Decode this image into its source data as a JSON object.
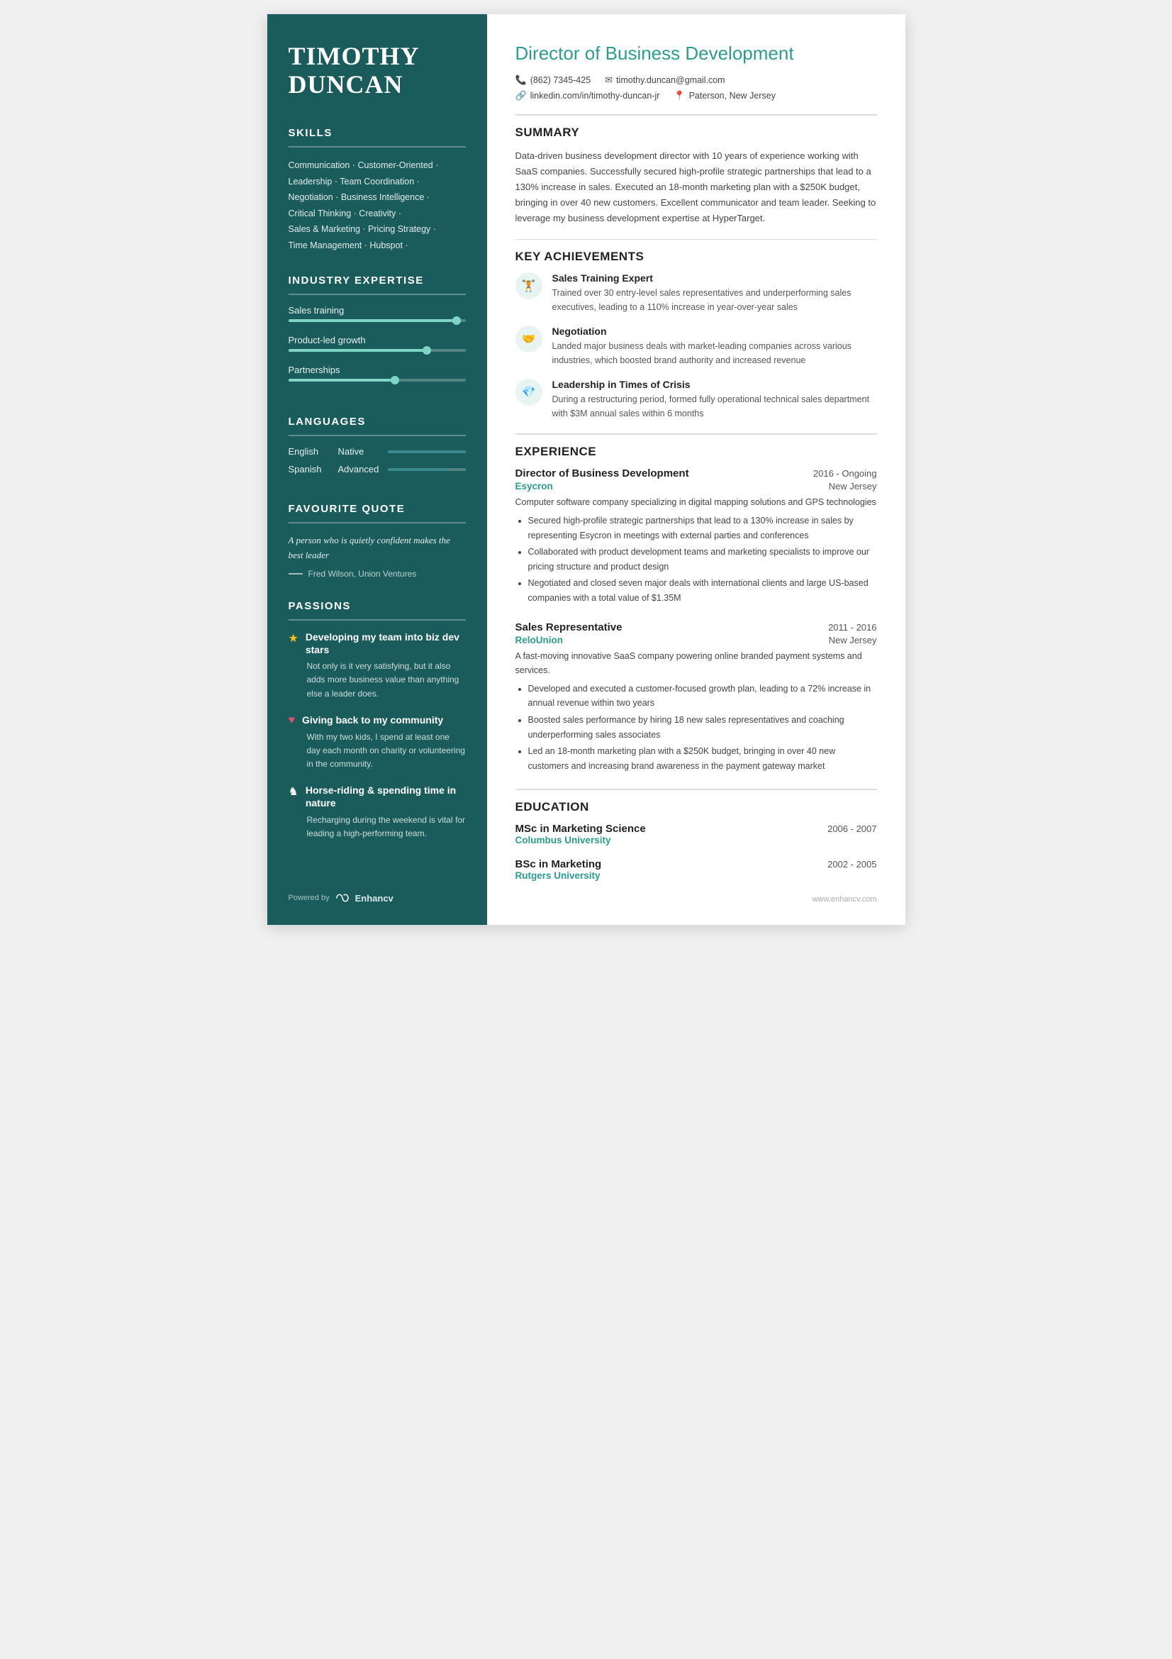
{
  "sidebar": {
    "name_line1": "TIMOTHY",
    "name_line2": "DUNCAN",
    "sections": {
      "skills": {
        "title": "SKILLS",
        "text_lines": [
          "Communication · Customer-Oriented ·",
          "Leadership · Team Coordination ·",
          "Negotiation · Business Intelligence ·",
          "Critical Thinking · Creativity ·",
          "Sales & Marketing · Pricing Strategy ·",
          "Time Management · Hubspot ·"
        ]
      },
      "expertise": {
        "title": "INDUSTRY EXPERTISE",
        "items": [
          {
            "label": "Sales training",
            "percent": 95
          },
          {
            "label": "Product-led growth",
            "percent": 78
          },
          {
            "label": "Partnerships",
            "percent": 60
          }
        ]
      },
      "languages": {
        "title": "LANGUAGES",
        "items": [
          {
            "name": "English",
            "level": "Native",
            "percent": 100
          },
          {
            "name": "Spanish",
            "level": "Advanced",
            "percent": 75
          }
        ]
      },
      "quote": {
        "title": "FAVOURITE QUOTE",
        "text": "A person who is quietly confident makes the best leader",
        "author": "Fred Wilson, Union Ventures"
      },
      "passions": {
        "title": "PASSIONS",
        "items": [
          {
            "icon": "★",
            "title": "Developing my team into biz dev stars",
            "desc": "Not only is it very satisfying, but it also adds more business value than anything else a leader does."
          },
          {
            "icon": "♥",
            "title": "Giving back to my community",
            "desc": "With my two kids, I spend at least one day each month on charity or volunteering in the community."
          },
          {
            "icon": "♞",
            "title": "Horse-riding & spending time in nature",
            "desc": "Recharging during the weekend is vital for leading a high-performing team."
          }
        ]
      }
    },
    "footer": {
      "powered_by": "Powered by",
      "logo_symbol": "∞",
      "logo_name": "Enhancv"
    }
  },
  "main": {
    "title": "Director of Business Development",
    "contact": {
      "phone_icon": "📞",
      "phone": "(862) 7345-425",
      "email_icon": "✉",
      "email": "timothy.duncan@gmail.com",
      "linkedin_icon": "🔗",
      "linkedin": "linkedin.com/in/timothy-duncan-jr",
      "location_icon": "📍",
      "location": "Paterson, New Jersey"
    },
    "summary": {
      "title": "SUMMARY",
      "text": "Data-driven business development director with 10 years of experience working with SaaS companies. Successfully secured high-profile strategic partnerships that lead to a 130% increase in sales. Executed an 18-month marketing plan with a $250K budget, bringing in over 40 new customers. Excellent communicator and team leader. Seeking to leverage my business development expertise at HyperTarget."
    },
    "achievements": {
      "title": "KEY ACHIEVEMENTS",
      "items": [
        {
          "icon": "🏋",
          "title": "Sales Training Expert",
          "desc": "Trained over 30 entry-level sales representatives and underperforming sales executives, leading to a 110% increase in year-over-year sales"
        },
        {
          "icon": "🤝",
          "title": "Negotiation",
          "desc": "Landed major business deals with market-leading companies across various industries, which boosted brand authority and increased revenue"
        },
        {
          "icon": "💎",
          "title": "Leadership in Times of Crisis",
          "desc": "During a restructuring period, formed fully operational technical sales department with $3M annual sales within 6 months"
        }
      ]
    },
    "experience": {
      "title": "EXPERIENCE",
      "items": [
        {
          "title": "Director of Business Development",
          "dates": "2016 - Ongoing",
          "company": "Esycron",
          "location": "New Jersey",
          "desc": "Computer software company specializing in digital mapping solutions and GPS technologies",
          "bullets": [
            "Secured high-profile strategic partnerships that lead to a 130% increase in sales by representing Esycron in meetings with external parties and conferences",
            "Collaborated with product development teams and marketing specialists to improve our pricing structure and product design",
            "Negotiated and closed seven major deals with international clients and large US-based companies with a total value of $1.35M"
          ]
        },
        {
          "title": "Sales Representative",
          "dates": "2011 - 2016",
          "company": "ReloUnion",
          "location": "New Jersey",
          "desc": "A fast-moving innovative SaaS company powering online branded payment systems and services.",
          "bullets": [
            "Developed and executed a customer-focused growth plan, leading to a 72% increase in annual revenue within two years",
            "Boosted sales performance by hiring 18 new sales representatives and coaching underperforming sales associates",
            "Led an 18-month marketing plan with a $250K budget, bringing in over 40 new customers and increasing brand awareness in the payment gateway market"
          ]
        }
      ]
    },
    "education": {
      "title": "EDUCATION",
      "items": [
        {
          "degree": "MSc in Marketing Science",
          "dates": "2006 - 2007",
          "school": "Columbus University"
        },
        {
          "degree": "BSc in Marketing",
          "dates": "2002 - 2005",
          "school": "Rutgers University"
        }
      ]
    },
    "footer": {
      "url": "www.enhancv.com"
    }
  }
}
